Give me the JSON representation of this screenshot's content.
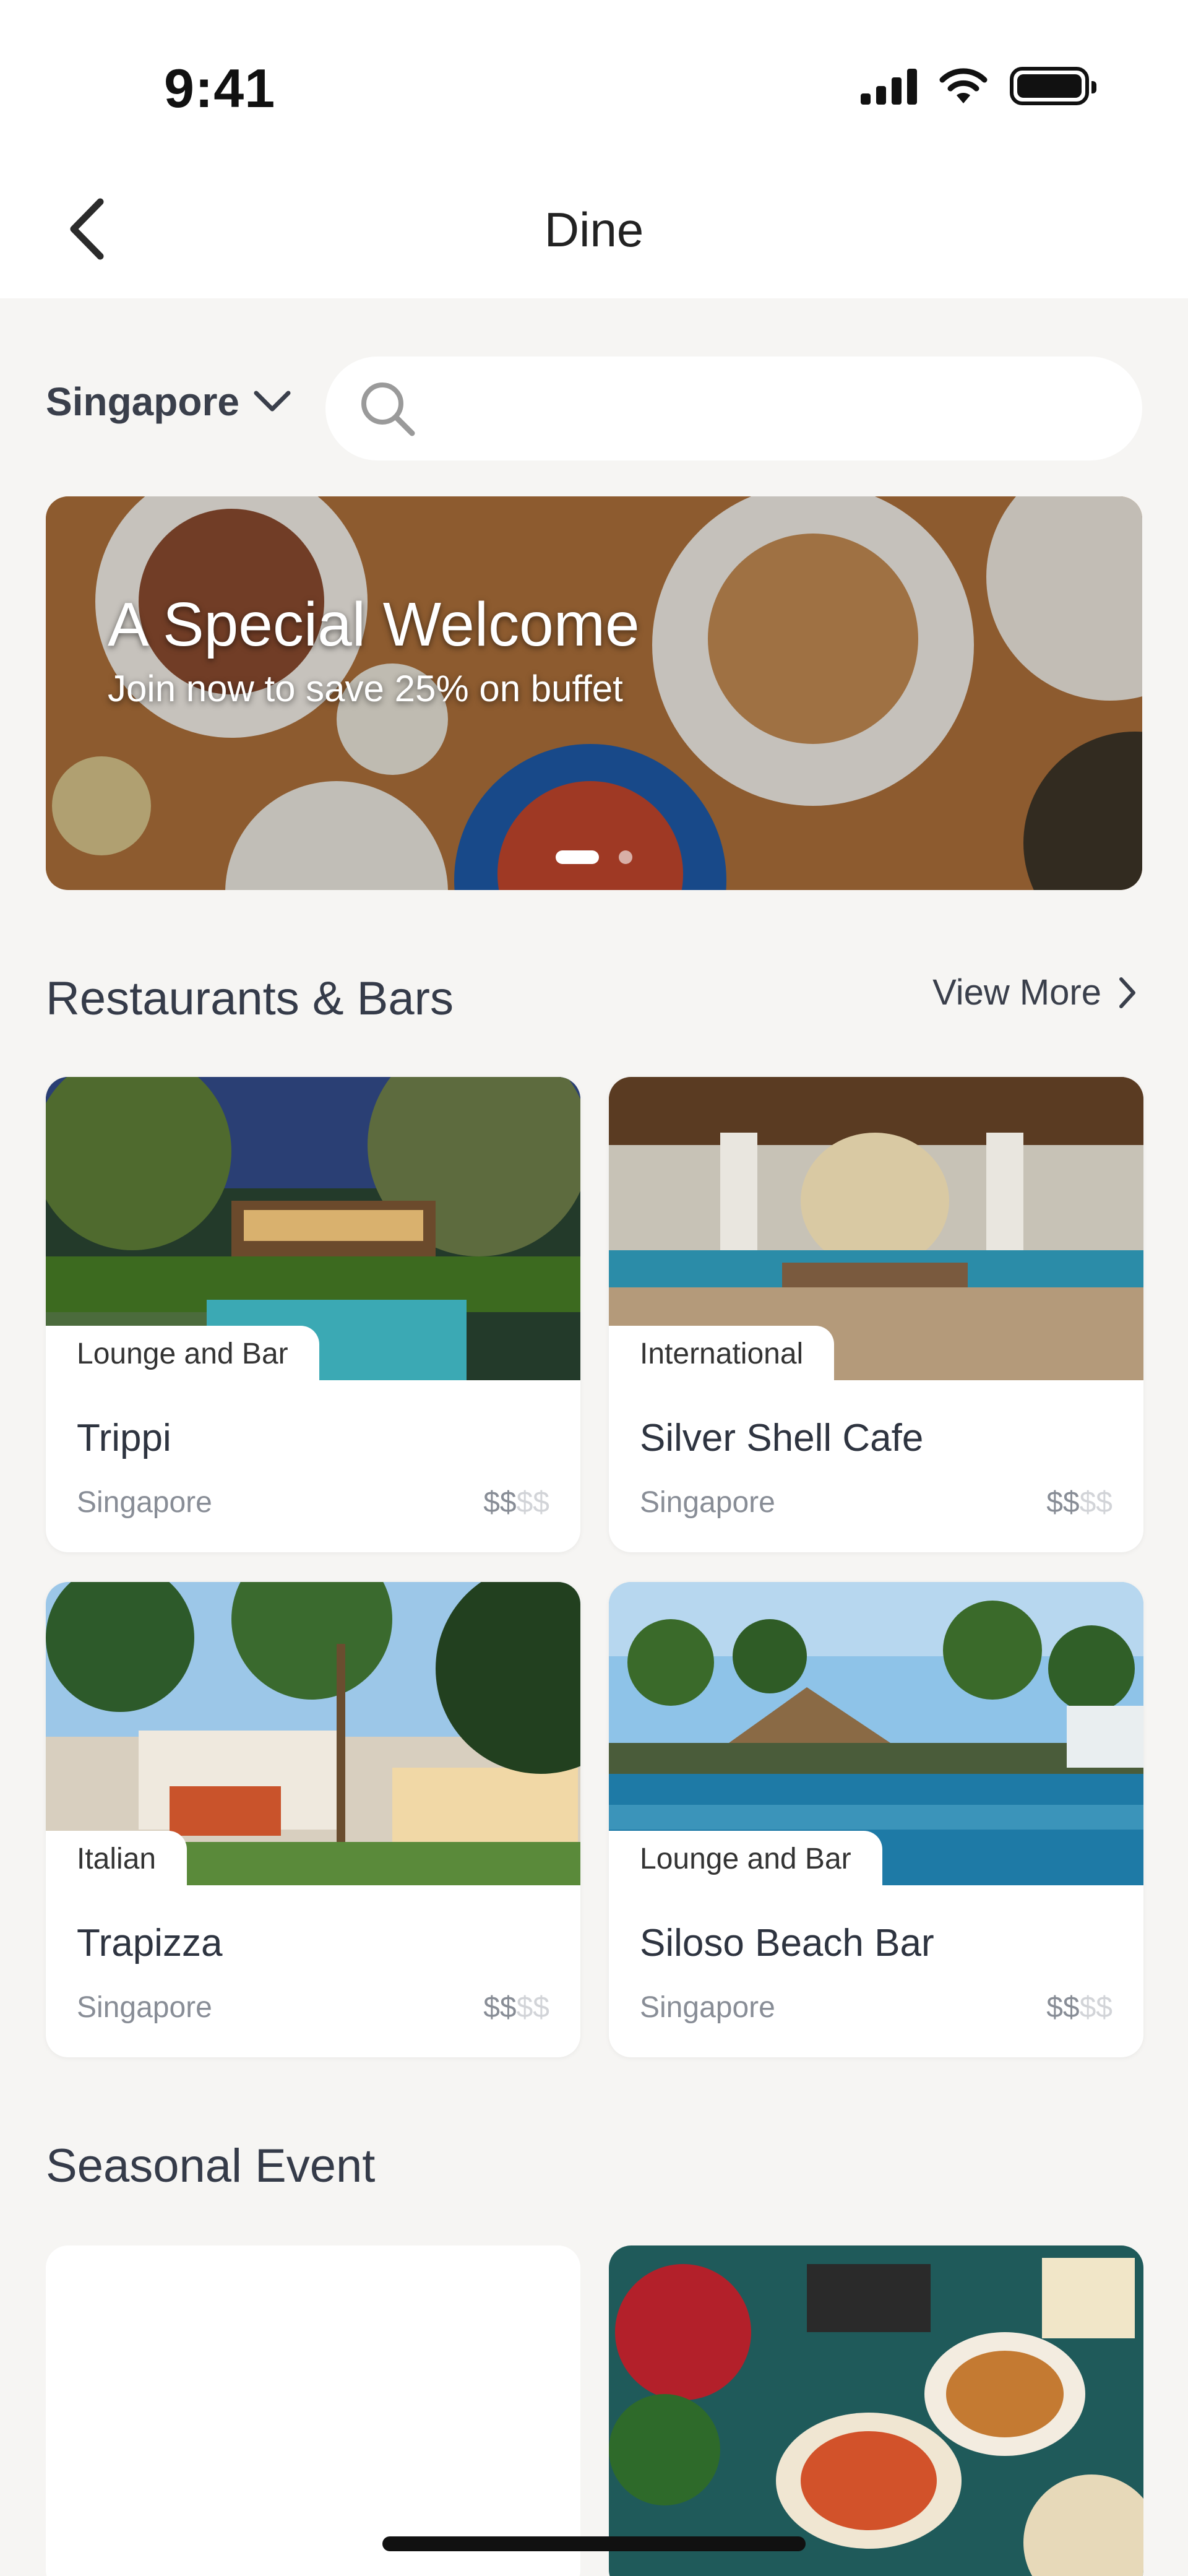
{
  "status_bar": {
    "time": "9:41"
  },
  "header": {
    "title": "Dine"
  },
  "location": {
    "label": "Singapore"
  },
  "search": {
    "placeholder": ""
  },
  "banner": {
    "title": "A Special Welcome",
    "subtitle": "Join now to save 25% on buffet",
    "slides": 2,
    "active_slide": 1
  },
  "restaurants": {
    "title": "Restaurants & Bars",
    "view_more": "View More",
    "items": [
      {
        "tag": "Lounge and Bar",
        "name": "Trippi",
        "location": "Singapore",
        "price_active": "$$",
        "price_inactive": "$$"
      },
      {
        "tag": "International",
        "name": "Silver Shell Cafe",
        "location": "Singapore",
        "price_active": "$$",
        "price_inactive": "$$"
      },
      {
        "tag": "Italian",
        "name": "Trapizza",
        "location": "Singapore",
        "price_active": "$$",
        "price_inactive": "$$"
      },
      {
        "tag": "Lounge and Bar",
        "name": "Siloso Beach Bar",
        "location": "Singapore",
        "price_active": "$$",
        "price_inactive": "$$"
      }
    ]
  },
  "seasonal": {
    "title": "Seasonal Event"
  },
  "colors": {
    "background": "#f6f5f3",
    "card": "#ffffff",
    "text": "#2e3440",
    "muted": "#888d96"
  }
}
